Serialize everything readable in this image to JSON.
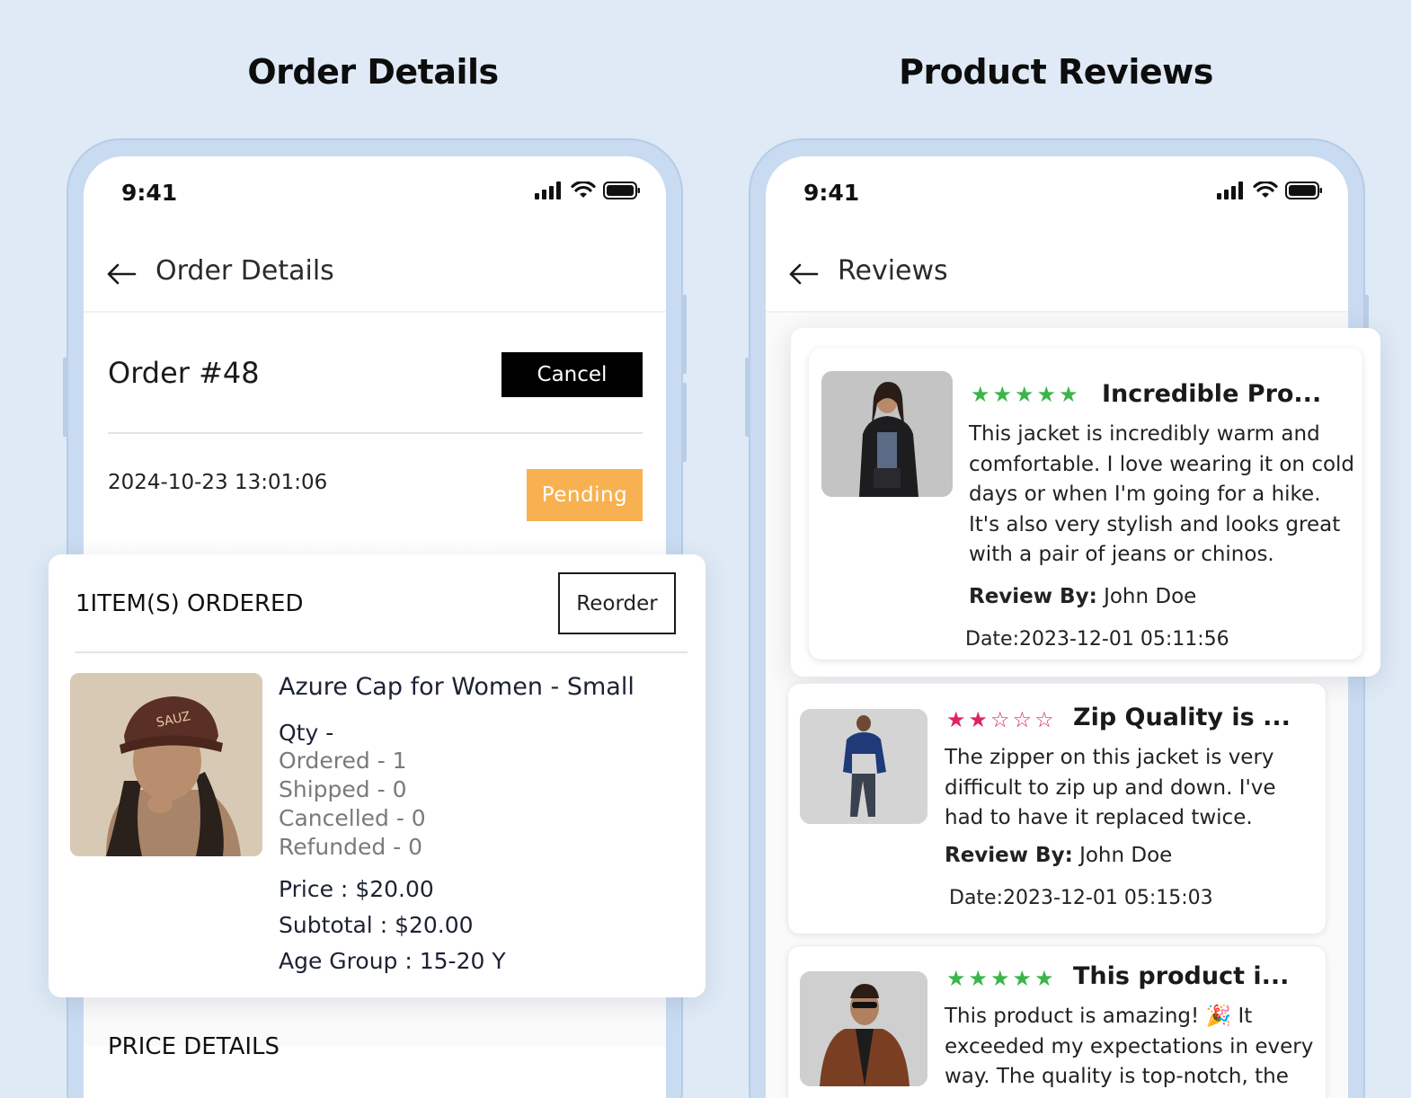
{
  "sections": {
    "left_title": "Order Details",
    "right_title": "Product Reviews"
  },
  "status_bar": {
    "time": "9:41"
  },
  "order_screen": {
    "nav_title": "Order Details",
    "order_number": "Order #48",
    "cancel_label": "Cancel",
    "order_date": "2024-10-23 13:01:06",
    "status": "Pending",
    "status_color": "#f8b150",
    "price_details_title": "PRICE DETAILS",
    "items_card": {
      "title": "1ITEM(S) ORDERED",
      "reorder_label": "Reorder",
      "product": {
        "name": "Azure Cap for Women - Small",
        "qty_label": "Qty -",
        "ordered": "Ordered - 1",
        "shipped": "Shipped - 0",
        "cancelled": "Cancelled - 0",
        "refunded": "Refunded - 0",
        "price_label": "Price :",
        "price_value": "$20.00",
        "subtotal_label": "Subtotal :",
        "subtotal_value": "$20.00",
        "age_label": "Age Group :",
        "age_value": "15-20 Y"
      }
    }
  },
  "reviews_screen": {
    "nav_title": "Reviews",
    "reviews": [
      {
        "rating": 5,
        "star_color": "#3ab54a",
        "title": "Incredible Pro...",
        "body": "This jacket is incredibly warm and comfortable. I love wearing it on cold days or when I'm going for a hike. It's also very stylish and looks great with a pair of jeans or chinos.",
        "by_label": "Review By:",
        "by_name": "John Doe",
        "date": "Date:2023-12-01 05:11:56"
      },
      {
        "rating": 2,
        "star_color": "#e0245e",
        "title": "Zip Quality is ...",
        "body": "The zipper on this jacket is very difficult to zip up and down. I've had to have it replaced twice.",
        "by_label": "Review By:",
        "by_name": "John Doe",
        "date": "Date:2023-12-01 05:15:03"
      },
      {
        "rating": 5,
        "star_color": "#3ab54a",
        "title": "This product i...",
        "body": "This product is amazing! 🎉 It exceeded my expectations in every way. The quality is top-notch, the",
        "by_label": "",
        "by_name": "",
        "date": ""
      }
    ]
  }
}
